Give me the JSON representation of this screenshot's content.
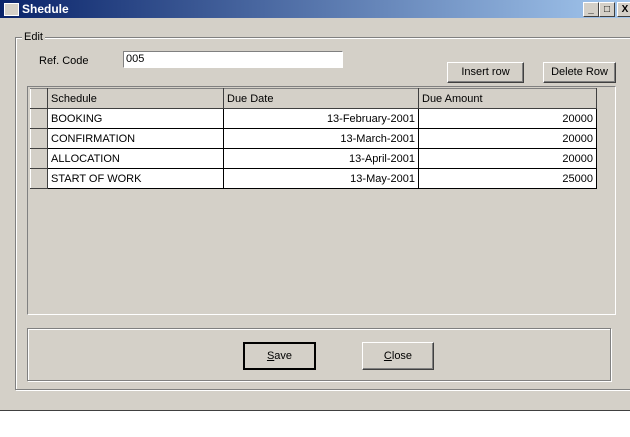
{
  "window": {
    "title": "Shedule",
    "minimize": "_",
    "maximize": "□",
    "close": "X"
  },
  "edit_group": {
    "legend": "Edit",
    "ref_label": "Ref. Code",
    "ref_value": "005"
  },
  "buttons": {
    "insert": "Insert row",
    "delete": "Delete Row",
    "save_u": "S",
    "save_rest": "ave",
    "close_u": "C",
    "close_rest": "lose"
  },
  "grid": {
    "columns": [
      "Schedule",
      "Due Date",
      "Due Amount"
    ],
    "rows": [
      {
        "schedule": "BOOKING",
        "date": "13-February-2001",
        "amount": "20000"
      },
      {
        "schedule": "CONFIRMATION",
        "date": "13-March-2001",
        "amount": "20000"
      },
      {
        "schedule": "ALLOCATION",
        "date": "13-April-2001",
        "amount": "20000"
      },
      {
        "schedule": "START OF WORK",
        "date": "13-May-2001",
        "amount": "25000"
      }
    ]
  }
}
